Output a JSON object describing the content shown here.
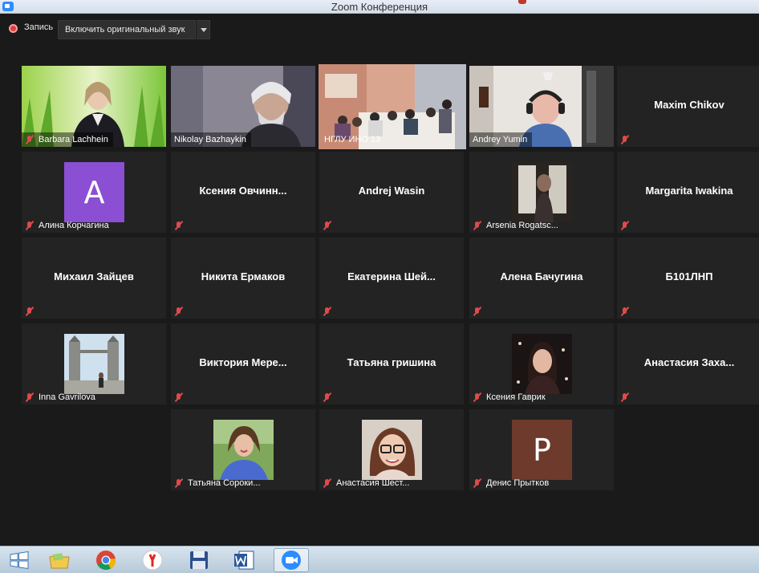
{
  "window": {
    "title": "Zoom Конференция"
  },
  "recording": {
    "label": "Запись",
    "original_sound_button": "Включить оригинальный звук"
  },
  "participants": [
    {
      "name": "Barbara Lachhein",
      "kind": "video"
    },
    {
      "name": "Nikolay Bazhaykin",
      "kind": "video"
    },
    {
      "name": "НГЛУ ИНО 13",
      "kind": "video",
      "active_speaker": true
    },
    {
      "name": "Andrey Yumin",
      "kind": "video"
    },
    {
      "name": "Maxim Chikov",
      "kind": "name_only"
    },
    {
      "name": "Алина Корчагина",
      "kind": "avatar",
      "avatar_letter": "A",
      "avatar_color": "#8a4fd2"
    },
    {
      "name": "Ксения  Овчинн...",
      "kind": "name_only"
    },
    {
      "name": "Andrej Wasin",
      "kind": "name_only"
    },
    {
      "name": "Arsenia Rogatsc...",
      "kind": "photo"
    },
    {
      "name": "Margarita Iwakina",
      "kind": "name_only"
    },
    {
      "name": "Михаил Зайцев",
      "kind": "name_only"
    },
    {
      "name": "Никита Ермаков",
      "kind": "name_only"
    },
    {
      "name": "Екатерина  Шей...",
      "kind": "name_only"
    },
    {
      "name": "Алена Бачугина",
      "kind": "name_only"
    },
    {
      "name": "Б101ЛНП",
      "kind": "name_only"
    },
    {
      "name": "Inna Gavrilova",
      "kind": "photo"
    },
    {
      "name": "Виктория  Мере...",
      "kind": "name_only"
    },
    {
      "name": "Татьяна гришина",
      "kind": "name_only"
    },
    {
      "name": "Ксения Гаврик",
      "kind": "photo"
    },
    {
      "name": "Анастасия  Заха...",
      "kind": "name_only"
    },
    {
      "name": "Татьяна Сороки...",
      "kind": "photo"
    },
    {
      "name": "Анастасия Шест...",
      "kind": "photo"
    },
    {
      "name": "Денис Прытков",
      "kind": "avatar",
      "avatar_letter": "P",
      "avatar_color": "#6e3a2c"
    }
  ],
  "taskbar": {
    "items": [
      {
        "icon": "windows-start-icon"
      },
      {
        "icon": "file-explorer-icon"
      },
      {
        "icon": "chrome-icon"
      },
      {
        "icon": "yandex-browser-icon"
      },
      {
        "icon": "save-disk-icon"
      },
      {
        "icon": "word-icon"
      },
      {
        "icon": "zoom-icon",
        "active": true
      }
    ]
  },
  "colors": {
    "active_speaker_border": "#f2e64a",
    "muted_icon": "#e04a4a",
    "recording_dot": "#e03e3e"
  }
}
